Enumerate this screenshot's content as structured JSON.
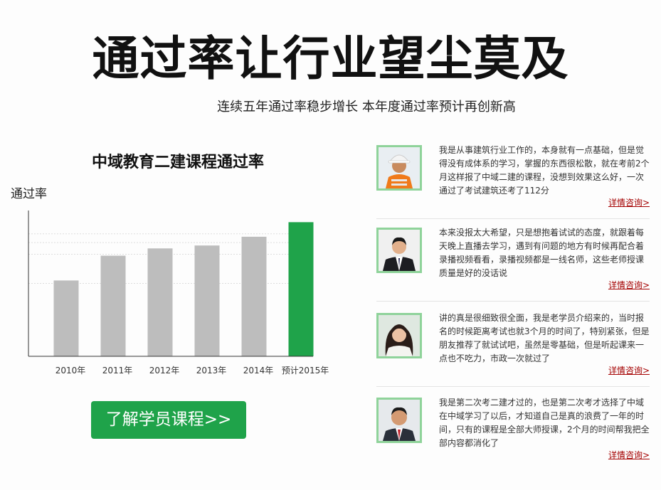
{
  "hero": {
    "title": "通过率让行业望尘莫及",
    "subtitle": "连续五年通过率稳步增长  本年度通过率预计再创新高"
  },
  "chart_data": {
    "type": "bar",
    "title": "中域教育二建课程通过率",
    "ylabel": "通过率",
    "xlabel": "",
    "categories": [
      "2010年",
      "2011年",
      "2012年",
      "2013年",
      "2014年",
      "预计2015年"
    ],
    "values": [
      52,
      69,
      74,
      76,
      82,
      92
    ],
    "ylim": [
      0,
      100
    ],
    "highlight_index": 5,
    "colors": {
      "bar": "#bdbdbd",
      "highlight": "#1fa34a",
      "axis": "#333333",
      "grid": "#dddddd"
    }
  },
  "cta": {
    "label": "了解学员课程>>",
    "color": "#1fa34a"
  },
  "testimonials": [
    {
      "text": "我是从事建筑行业工作的，本身就有一点基础，但是觉得没有成体系的学习，掌握的东西很松散，就在考前2个月这样报了中域二建的课程，没想到效果这么好，一次通过了考试建筑还考了112分",
      "link": "详情咨询>",
      "avatar": "construction-worker-photo"
    },
    {
      "text": "本来没报太大希望，只是想抱着试试的态度，就跟着每天晚上直播去学习，遇到有问题的地方有时候再配合着录播视频看看，录播视频都是一线名师，这些老师授课质量是好的没话说",
      "link": "详情咨询>",
      "avatar": "businessman-photo"
    },
    {
      "text": "讲的真是很细致很全面，我是老学员介绍来的，当时报名的时候距离考试也就3个月的时间了，特别紧张，但是朋友推荐了就试试吧，虽然是零基础，但是听起课来一点也不吃力，市政一次就过了",
      "link": "详情咨询>",
      "avatar": "woman-photo"
    },
    {
      "text": "我是第二次考二建才过的，也是第二次考才选择了中域在中域学习了以后，才知道自己是真的浪费了一年的时间，只有的课程是全部大师授课，2个月的时间帮我把全部内容都消化了",
      "link": "详情咨询>",
      "avatar": "man-red-tie-photo"
    }
  ]
}
